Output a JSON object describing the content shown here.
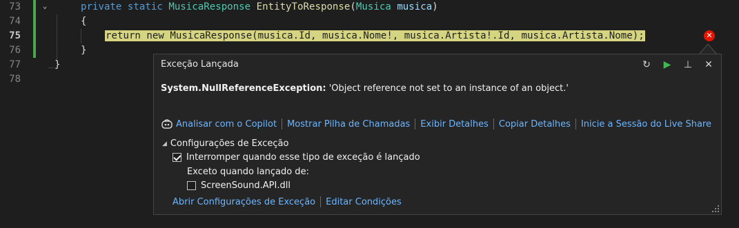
{
  "editor": {
    "lines": [
      {
        "num": "73"
      },
      {
        "num": "74"
      },
      {
        "num": "75"
      },
      {
        "num": "76"
      },
      {
        "num": "77"
      },
      {
        "num": "78"
      }
    ],
    "line73": {
      "kw1": "private",
      "kw2": "static",
      "type": "MusicaResponse",
      "method": "EntityToResponse",
      "open": "(",
      "ptype": "Musica",
      "param": "musica",
      "close": ")"
    },
    "line74": {
      "text": "{"
    },
    "line75": {
      "kw_return": "return",
      "kw_new": "new",
      "rest": "MusicaResponse(musica.Id, musica.Nome!, musica.Artista!.Id, musica.Artista.Nome);"
    },
    "line76": {
      "text": "}"
    },
    "line77": {
      "text": "}"
    },
    "error_glyph": "✕"
  },
  "popup": {
    "title": "Exceção Lançada",
    "exception_type": "System.NullReferenceException:",
    "exception_message": "'Object reference not set to an instance of an object.'",
    "toolbar": {
      "history_glyph": "↻",
      "continue_glyph": "▶",
      "pin_glyph": "⊥",
      "close_glyph": "✕"
    },
    "actions": [
      "Analisar com o Copilot",
      "Mostrar Pilha de Chamadas",
      "Exibir Detalhes",
      "Copiar Detalhes",
      "Inicie a Sessão do Live Share"
    ],
    "settings": {
      "header": "Configurações de Exceção",
      "break_when_thrown": {
        "label": "Interromper quando esse tipo de exceção é lançado",
        "checked": true
      },
      "except_label": "Exceto quando lançado de:",
      "module": {
        "label": "ScreenSound.API.dll",
        "checked": false
      }
    },
    "bottom_links": [
      "Abrir Configurações de Exceção",
      "Editar Condições"
    ]
  },
  "colors": {
    "background": "#1e1e1e",
    "keyword": "#569cd6",
    "type": "#4ec9b0",
    "method": "#dcdcaa",
    "highlight": "#d5d581",
    "link": "#6cb6ff",
    "error": "#e51400"
  }
}
